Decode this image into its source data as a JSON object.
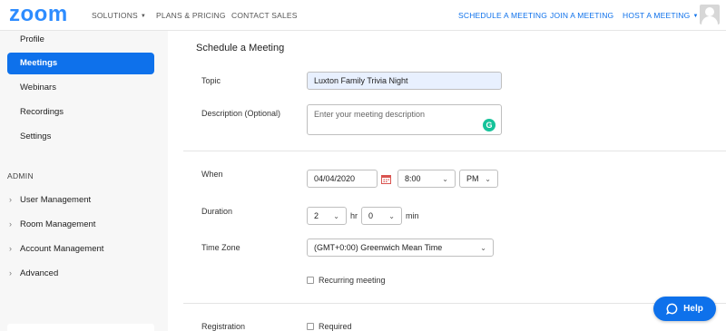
{
  "header": {
    "logo": "zoom",
    "nav_left": [
      {
        "label": "SOLUTIONS",
        "dropdown": true
      },
      {
        "label": "PLANS & PRICING",
        "dropdown": false
      },
      {
        "label": "CONTACT SALES",
        "dropdown": false
      }
    ],
    "nav_right": [
      {
        "label": "SCHEDULE A MEETING",
        "dropdown": false
      },
      {
        "label": "JOIN A MEETING",
        "dropdown": false
      },
      {
        "label": "HOST A MEETING",
        "dropdown": true
      }
    ],
    "caret": "▼"
  },
  "sidebar": {
    "items": [
      "Profile",
      "Meetings",
      "Webinars",
      "Recordings",
      "Settings"
    ],
    "active": "Meetings",
    "admin_heading": "ADMIN",
    "admin_items": [
      "User Management",
      "Room Management",
      "Account Management",
      "Advanced"
    ],
    "chevron": "›"
  },
  "form": {
    "section_title": "Schedule a Meeting",
    "topic": {
      "label": "Topic",
      "value": "Luxton Family Trivia Night"
    },
    "description": {
      "label": "Description (Optional)",
      "placeholder": "Enter your meeting description"
    },
    "when": {
      "label": "When",
      "date": "04/04/2020",
      "time": "8:00",
      "ampm": "PM"
    },
    "duration": {
      "label": "Duration",
      "hours": "2",
      "hours_unit": "hr",
      "minutes": "0",
      "minutes_unit": "min"
    },
    "timezone": {
      "label": "Time Zone",
      "value": "(GMT+0:00) Greenwich Mean Time"
    },
    "recurring": {
      "label": "Recurring meeting",
      "checked": false
    },
    "registration": {
      "label": "Registration",
      "option": "Required",
      "checked": false
    }
  },
  "help": {
    "label": "Help"
  },
  "colors": {
    "brand_blue": "#2d8cff",
    "accent_blue": "#0e71eb",
    "grammarly_green": "#15c39a",
    "sidebar_bg": "#f7f7f7"
  },
  "icons": [
    "chevron-down-icon",
    "calendar-icon",
    "grammarly-icon",
    "avatar-icon",
    "help-chat-icon"
  ]
}
